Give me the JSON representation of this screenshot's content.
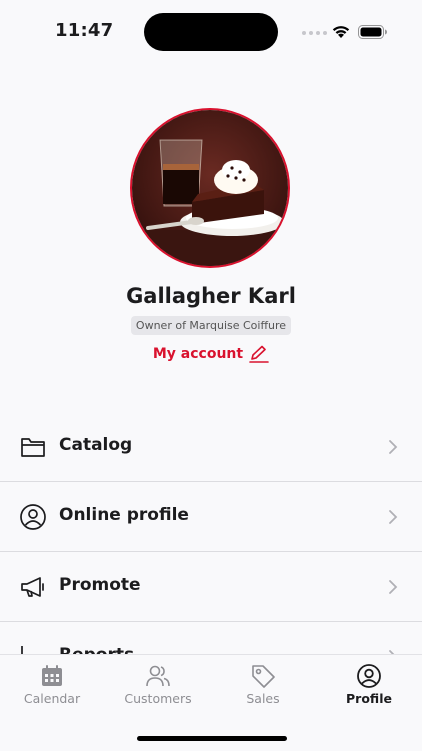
{
  "status_bar": {
    "time": "11:47"
  },
  "profile": {
    "name": "Gallagher Karl",
    "subtitle": "Owner of Marquise Coiffure",
    "account_link": "My account",
    "accent_color": "#d9122e"
  },
  "menu": [
    {
      "label": "Catalog",
      "icon": "folder-icon"
    },
    {
      "label": "Online profile",
      "icon": "user-circle-icon"
    },
    {
      "label": "Promote",
      "icon": "megaphone-icon"
    },
    {
      "label": "Reports",
      "icon": "chart-icon"
    }
  ],
  "tabs": [
    {
      "label": "Calendar",
      "icon": "calendar-icon",
      "active": false
    },
    {
      "label": "Customers",
      "icon": "users-icon",
      "active": false
    },
    {
      "label": "Sales",
      "icon": "tag-icon",
      "active": false
    },
    {
      "label": "Profile",
      "icon": "user-circle-icon",
      "active": true
    }
  ]
}
